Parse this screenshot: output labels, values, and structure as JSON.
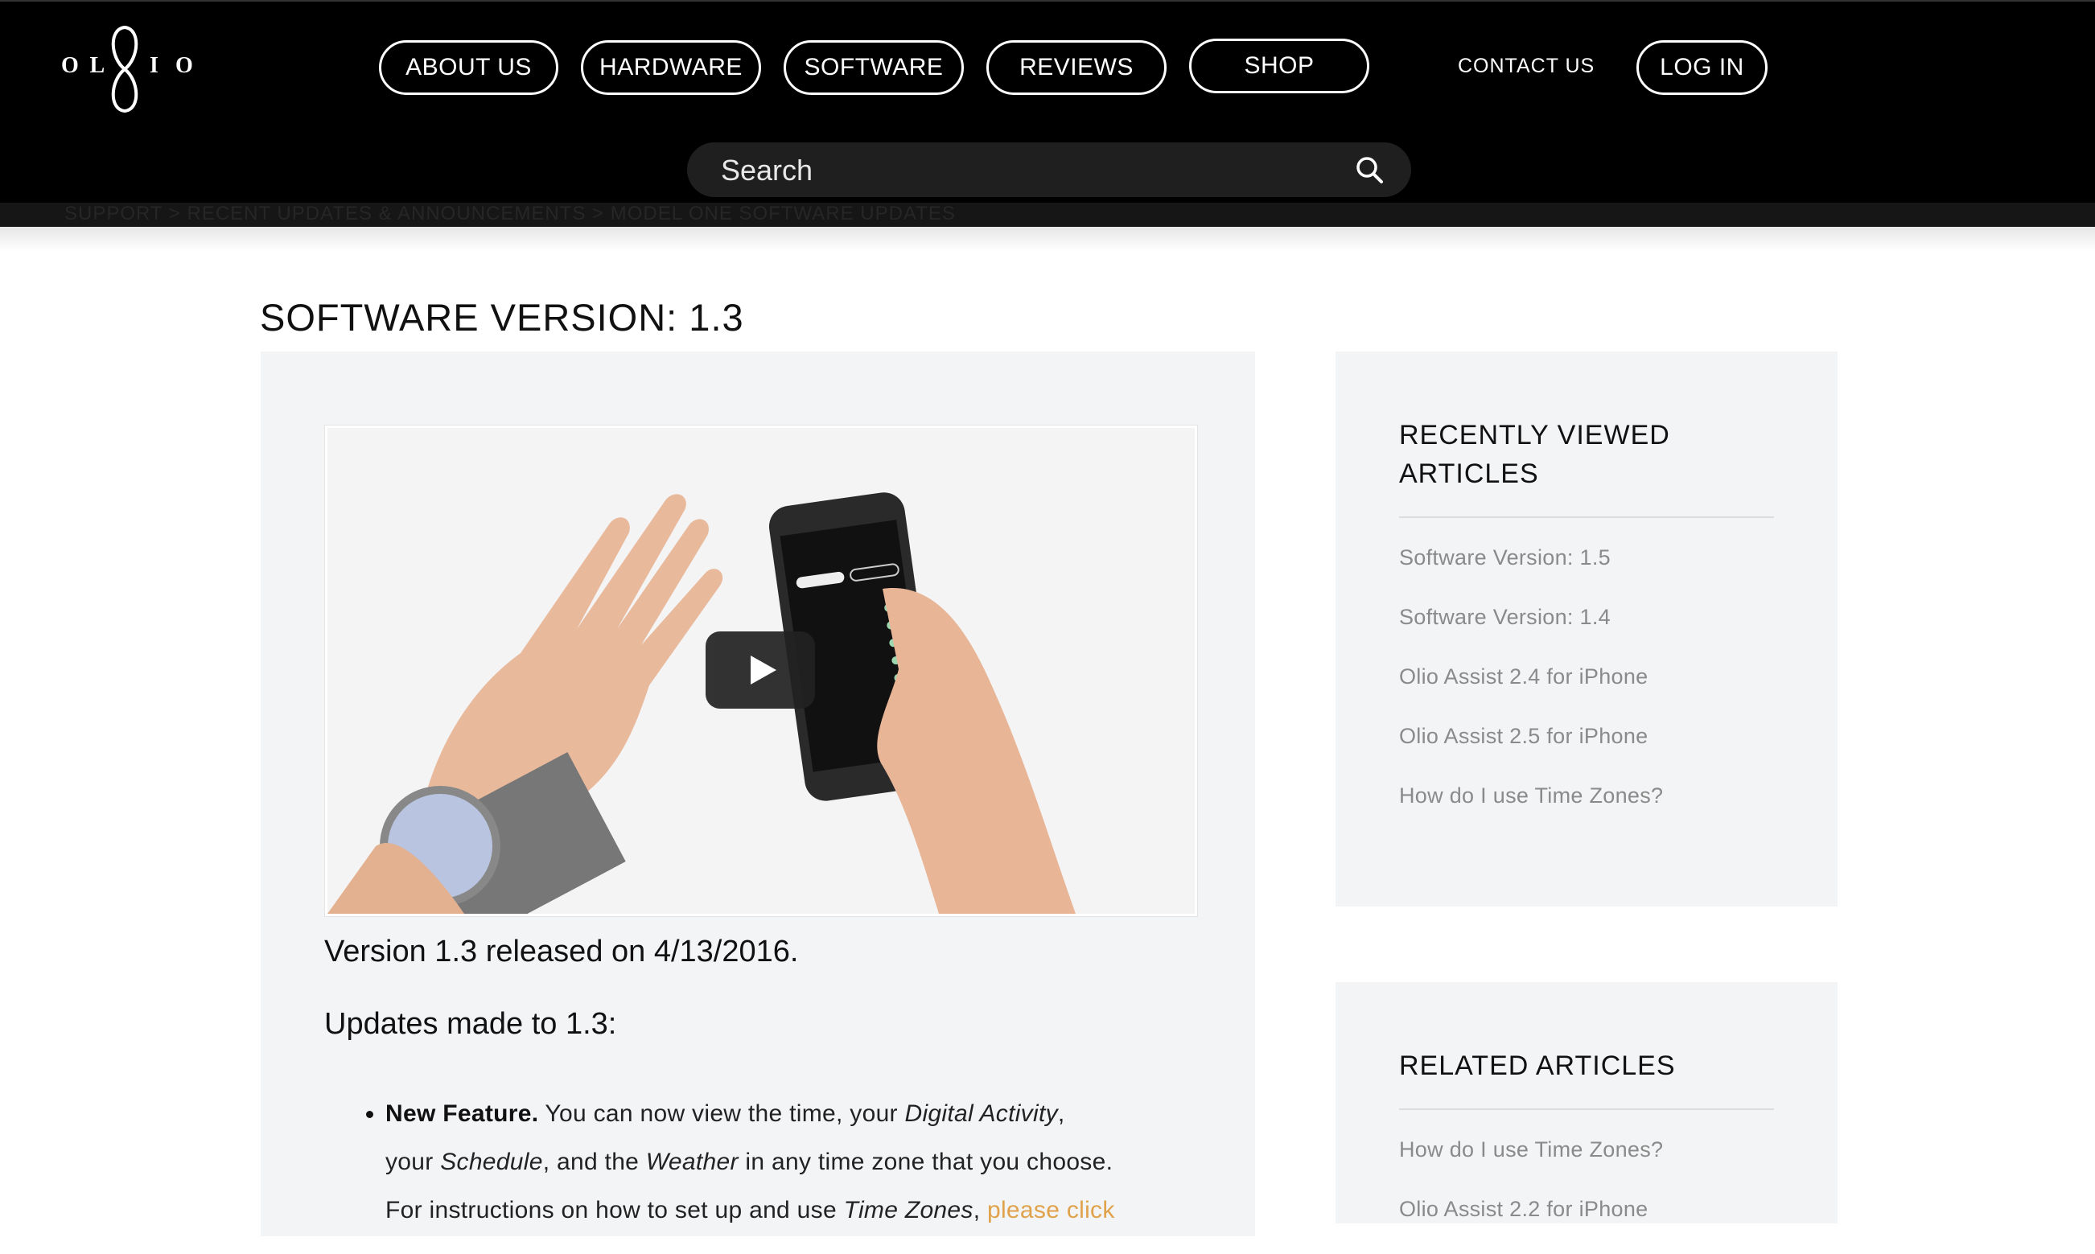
{
  "brand": {
    "logo_letters": [
      "O",
      "L",
      "I",
      "O"
    ]
  },
  "nav": {
    "items": [
      {
        "label": "ABOUT US"
      },
      {
        "label": "HARDWARE"
      },
      {
        "label": "SOFTWARE"
      },
      {
        "label": "REVIEWS"
      },
      {
        "label": "SHOP"
      }
    ],
    "contact_label": "CONTACT US",
    "login_label": "LOG IN"
  },
  "search": {
    "placeholder": "Search"
  },
  "breadcrumb": {
    "text": "SUPPORT  >  RECENT UPDATES & ANNOUNCEMENTS  >  MODEL ONE SOFTWARE UPDATES"
  },
  "article": {
    "title": "SOFTWARE VERSION: 1.3",
    "release": "Version 1.3 released on 4/13/2016.",
    "updates_heading": "Updates made to 1.3:",
    "bullet1": {
      "label": "New Feature.",
      "t1": " You can now view the time, your ",
      "e1": "Digital Activity",
      "t2": ",",
      "t3": "your ",
      "e2": "Schedule",
      "t4": ", and the ",
      "e3": "Weather",
      "t5": " in any time zone that you choose.",
      "t6": "For instructions on how to set up and use ",
      "e4": "Time Zones",
      "t7": ", ",
      "link": "please click"
    }
  },
  "sidebar": {
    "recently_viewed": {
      "heading": "RECENTLY VIEWED ARTICLES",
      "items": [
        "Software Version: 1.5",
        "Software Version: 1.4",
        "Olio Assist 2.4 for iPhone",
        "Olio Assist 2.5 for iPhone",
        "How do I use Time Zones?"
      ]
    },
    "related": {
      "heading": "RELATED ARTICLES",
      "items": [
        "How do I use Time Zones?",
        "Olio Assist 2.2 for iPhone"
      ]
    }
  },
  "colors": {
    "header_bg": "#000000",
    "card_bg": "#f3f4f6",
    "link": "#e0a24a",
    "muted_text": "#8a8a8a"
  },
  "icons": {
    "search": "search-icon",
    "play": "play-icon",
    "logo": "olio-infinity-logo"
  }
}
